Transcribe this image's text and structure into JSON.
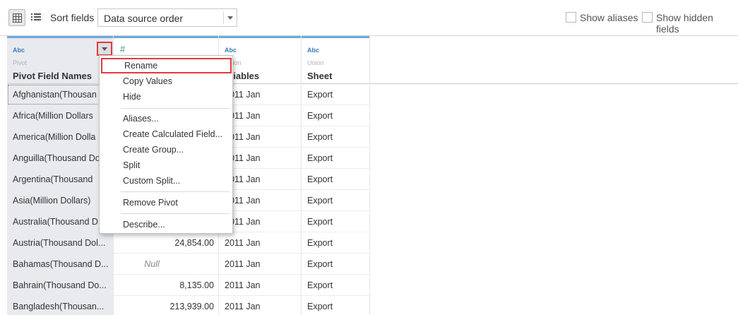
{
  "toolbar": {
    "grid_icon": "grid-view-icon",
    "list_icon": "list-view-icon",
    "sort_label": "Sort fields",
    "sort_value": "Data source order",
    "show_aliases": "Show aliases",
    "show_hidden": "Show hidden fields"
  },
  "columns": [
    {
      "type": "Abc",
      "origin": "Pivot",
      "name": "Pivot Field Names"
    },
    {
      "type": "#",
      "origin": "",
      "name": ""
    },
    {
      "type": "Abc",
      "origin": "Union",
      "name": "ariables"
    },
    {
      "type": "Abc",
      "origin": "Union",
      "name": "Sheet"
    }
  ],
  "rows": [
    {
      "name": "Afghanistan(Thousan",
      "value": "",
      "date": "2011 Jan",
      "sheet": "Export"
    },
    {
      "name": "Africa(Million Dollars",
      "value": "",
      "date": "2011 Jan",
      "sheet": "Export"
    },
    {
      "name": "America(Million Dolla",
      "value": "",
      "date": "2011 Jan",
      "sheet": "Export"
    },
    {
      "name": "Anguilla(Thousand Do",
      "value": "",
      "date": "2011 Jan",
      "sheet": "Export"
    },
    {
      "name": "Argentina(Thousand",
      "value": "",
      "date": "2011 Jan",
      "sheet": "Export"
    },
    {
      "name": "Asia(Million Dollars)",
      "value": "",
      "date": "2011 Jan",
      "sheet": "Export"
    },
    {
      "name": "Australia(Thousand D",
      "value": "",
      "date": "2011 Jan",
      "sheet": "Export"
    },
    {
      "name": "Austria(Thousand Dol...",
      "value": "24,854.00",
      "date": "2011 Jan",
      "sheet": "Export"
    },
    {
      "name": "Bahamas(Thousand D...",
      "value": "Null",
      "date": "2011 Jan",
      "sheet": "Export"
    },
    {
      "name": "Bahrain(Thousand Do...",
      "value": "8,135.00",
      "date": "2011 Jan",
      "sheet": "Export"
    },
    {
      "name": "Bangladesh(Thousan...",
      "value": "213,939.00",
      "date": "2011 Jan",
      "sheet": "Export"
    }
  ],
  "menu": {
    "items": [
      "Rename",
      "Copy Values",
      "Hide",
      "Aliases...",
      "Create Calculated Field...",
      "Create Group...",
      "Split",
      "Custom Split...",
      "Remove Pivot",
      "Describe..."
    ]
  },
  "colors": {
    "highlight": "#e23b3b",
    "header_accent": "#6fa8d9",
    "type_text": "#3d7bb8",
    "number_icon": "#2a9d7a"
  }
}
